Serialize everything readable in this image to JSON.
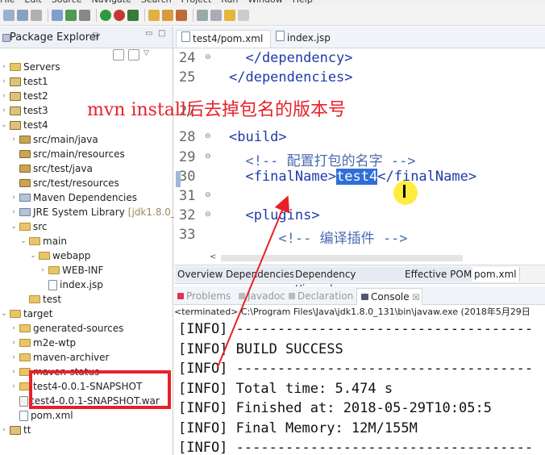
{
  "menubar": [
    "File",
    "Edit",
    "Source",
    "Navigate",
    "Search",
    "Project",
    "Run",
    "Window",
    "Help"
  ],
  "package_explorer": {
    "title": "Package Explorer",
    "close": "☒",
    "min": "▭",
    "max": "□",
    "tree": [
      {
        "label": "Servers",
        "arrow": "›",
        "icon": "folder"
      },
      {
        "label": "test1",
        "arrow": "›",
        "icon": "project"
      },
      {
        "label": "test2",
        "arrow": "›",
        "icon": "project"
      },
      {
        "label": "test3",
        "arrow": "›",
        "icon": "project"
      },
      {
        "label": "test4",
        "arrow": "⌄",
        "icon": "project"
      },
      {
        "label": "src/main/java",
        "arrow": "›",
        "icon": "package"
      },
      {
        "label": "src/main/resources",
        "arrow": "",
        "icon": "package"
      },
      {
        "label": "src/test/java",
        "arrow": "",
        "icon": "package"
      },
      {
        "label": "src/test/resources",
        "arrow": "",
        "icon": "package"
      },
      {
        "label": "Maven Dependencies",
        "arrow": "›",
        "icon": "library"
      },
      {
        "label": "JRE System Library",
        "suffix": "[jdk1.8.0_1",
        "arrow": "›",
        "icon": "library"
      },
      {
        "label": "src",
        "arrow": "⌄",
        "icon": "folder"
      },
      {
        "label": "main",
        "arrow": "⌄",
        "icon": "folder"
      },
      {
        "label": "webapp",
        "arrow": "⌄",
        "icon": "folder"
      },
      {
        "label": "WEB-INF",
        "arrow": "›",
        "icon": "folder"
      },
      {
        "label": "index.jsp",
        "arrow": "",
        "icon": "file"
      },
      {
        "label": "test",
        "arrow": "",
        "icon": "folder"
      },
      {
        "label": "target",
        "arrow": "⌄",
        "icon": "folder"
      },
      {
        "label": "generated-sources",
        "arrow": "›",
        "icon": "folder"
      },
      {
        "label": "m2e-wtp",
        "arrow": "›",
        "icon": "folder"
      },
      {
        "label": "maven-archiver",
        "arrow": "›",
        "icon": "folder"
      },
      {
        "label": "maven-status",
        "arrow": "›",
        "icon": "folder"
      },
      {
        "label": "test4-0.0.1-SNAPSHOT",
        "arrow": "›",
        "icon": "folder"
      },
      {
        "label": "test4-0.0.1-SNAPSHOT.war",
        "arrow": "",
        "icon": "war"
      },
      {
        "label": "pom.xml",
        "arrow": "",
        "icon": "file"
      },
      {
        "label": "tt",
        "arrow": "›",
        "icon": "project"
      }
    ]
  },
  "editor": {
    "tabs": [
      {
        "label": "test4/pom.xml",
        "close": "☒",
        "active": true
      },
      {
        "label": "index.jsp",
        "active": false
      }
    ],
    "lines": [
      {
        "n": "24",
        "code": "  </dependency>"
      },
      {
        "n": "25",
        "code": "</dependencies>"
      },
      {
        "n": "27",
        "code": ""
      },
      {
        "n": "28",
        "code": "<build>"
      },
      {
        "n": "29",
        "code": "  <!-- 配置打包的名字 -->"
      },
      {
        "n": "30",
        "code_pre": "  <finalName>",
        "code_sel": "test4",
        "code_post": "</finalName>"
      },
      {
        "n": "31",
        "code": ""
      },
      {
        "n": "32",
        "code": "  <plugins>"
      },
      {
        "n": "33",
        "code": "      <!-- 编译插件 -->"
      }
    ],
    "scroll_left": "<",
    "pom_tabs": [
      "Overview",
      "Dependencies",
      "Dependency Hierarchy",
      "Effective POM",
      "pom.xml"
    ]
  },
  "console": {
    "tabs": [
      {
        "label": "Problems",
        "active": false
      },
      {
        "label": "Javadoc",
        "active": false
      },
      {
        "label": "Declaration",
        "active": false
      },
      {
        "label": "Console",
        "close": "☒",
        "active": true
      }
    ],
    "terminated": "<terminated> C:\\Program Files\\Java\\jdk1.8.0_131\\bin\\javaw.exe (2018年5月29日",
    "lines": [
      "[INFO] ------------------------------------",
      "[INFO] BUILD SUCCESS",
      "[INFO] ------------------------------------",
      "[INFO] Total time: 5.474 s",
      "[INFO] Finished at: 2018-05-29T10:05:5",
      "[INFO] Final Memory: 12M/155M",
      "[INFO] ------------------------------------"
    ]
  },
  "annotation": {
    "text": "mvn install后去掉包名的版本号",
    "color": "#e8202a"
  }
}
